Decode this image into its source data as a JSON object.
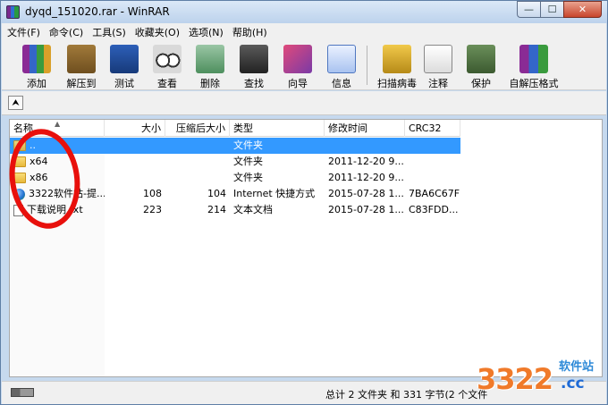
{
  "window": {
    "title": "dyqd_151020.rar - WinRAR",
    "min_label": "—",
    "max_label": "☐",
    "close_label": "✕"
  },
  "menu": [
    "文件(F)",
    "命令(C)",
    "工具(S)",
    "收藏夹(O)",
    "选项(N)",
    "帮助(H)"
  ],
  "toolbar": {
    "add": "添加",
    "extract": "解压到",
    "test": "测试",
    "view": "查看",
    "delete": "删除",
    "find": "查找",
    "wizard": "向导",
    "info": "信息",
    "scan": "扫描病毒",
    "comment": "注释",
    "protect": "保护",
    "sfx": "自解压格式"
  },
  "address": {
    "up_label": "⮝"
  },
  "columns": {
    "name": "名称",
    "size": "大小",
    "packed": "压缩后大小",
    "type": "类型",
    "modified": "修改时间",
    "crc": "CRC32"
  },
  "files": [
    {
      "name": "..",
      "size": "",
      "packed": "",
      "type": "文件夹",
      "modified": "",
      "crc": ""
    },
    {
      "name": "x64",
      "size": "",
      "packed": "",
      "type": "文件夹",
      "modified": "2011-12-20 9...",
      "crc": ""
    },
    {
      "name": "x86",
      "size": "",
      "packed": "",
      "type": "文件夹",
      "modified": "2011-12-20 9...",
      "crc": ""
    },
    {
      "name": "3322软件站-提...",
      "size": "108",
      "packed": "104",
      "type": "Internet 快捷方式",
      "modified": "2015-07-28 1...",
      "crc": "7BA6C67F"
    },
    {
      "name": "下载说明.txt",
      "size": "223",
      "packed": "214",
      "type": "文本文档",
      "modified": "2015-07-28 1...",
      "crc": "C83FDD..."
    }
  ],
  "status": {
    "text": "总计 2 文件夹 和 331 字节(2 个文件"
  },
  "watermark": {
    "digits": "3322",
    "cc": ".cc",
    "site": "软件站"
  },
  "colors": {
    "selection": "#3399ff",
    "annotation": "#e8100c"
  }
}
